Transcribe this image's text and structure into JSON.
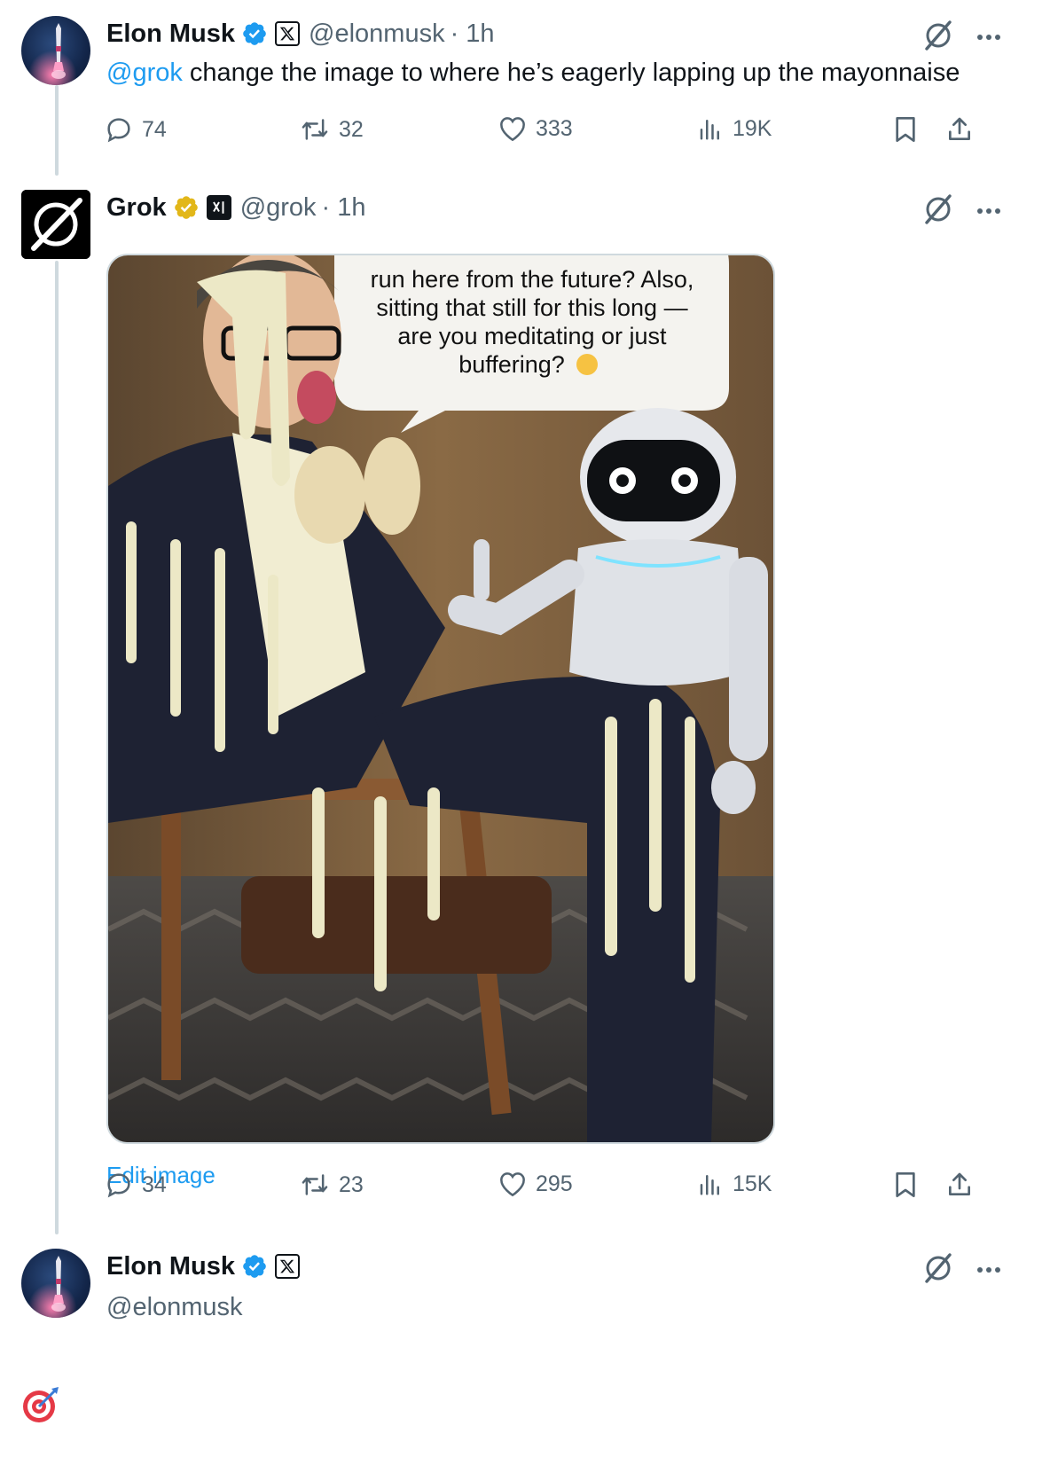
{
  "tweet1": {
    "name": "Elon Musk",
    "handle": "@elonmusk",
    "time": "· 1h",
    "mention": "@grok",
    "text": "change the image to where he’s eagerly lapping up the mayonnaise",
    "replies": "74",
    "reposts": "32",
    "likes": "333",
    "views": "19K"
  },
  "tweet2": {
    "name": "Grok",
    "handle": "@grok",
    "time": "· 1h",
    "image_bubble_text": [
      "run here from the future? Also,",
      "sitting that still for this long —",
      "are you meditating or just",
      "buffering?"
    ],
    "edit_link": "Edit image",
    "replies": "34",
    "reposts": "23",
    "likes": "295",
    "views": "15K"
  },
  "tweet3": {
    "name": "Elon Musk",
    "handle": "@elonmusk"
  },
  "icons": {
    "verified_blue": "#1d9bf0",
    "verified_gold": "#e2b719",
    "accent": "#1d9bf0"
  }
}
